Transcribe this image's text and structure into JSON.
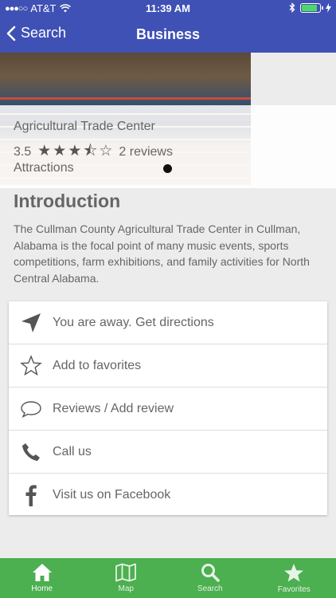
{
  "status": {
    "carrier": "AT&T",
    "time": "11:39 AM"
  },
  "nav": {
    "back_label": "Search",
    "title": "Business"
  },
  "business": {
    "name": "Agricultural Trade Center",
    "rating": "3.5",
    "stars": "★★★⯪☆",
    "reviews": "2 reviews",
    "category": "Attractions"
  },
  "intro": {
    "title": "Introduction",
    "text": "The Cullman County Agricultural Trade Center in Cullman, Alabama is the focal point of many music events, sports competitions, farm exhibitions, and family activities for North Central Alabama."
  },
  "actions": [
    {
      "label": "You are away. Get directions",
      "icon": "directions-arrow-icon"
    },
    {
      "label": "Add to favorites",
      "icon": "star-outline-icon"
    },
    {
      "label": "Reviews / Add review",
      "icon": "chat-bubble-icon"
    },
    {
      "label": "Call us",
      "icon": "phone-icon"
    },
    {
      "label": "Visit us on Facebook",
      "icon": "facebook-icon"
    }
  ],
  "tabs": [
    {
      "label": "Home",
      "icon": "home-icon"
    },
    {
      "label": "Map",
      "icon": "map-icon"
    },
    {
      "label": "Search",
      "icon": "search-icon"
    },
    {
      "label": "Favorites",
      "icon": "star-icon"
    }
  ],
  "colors": {
    "header": "#3f51b5",
    "tabbar": "#4caf50",
    "battery": "#4cd964"
  }
}
